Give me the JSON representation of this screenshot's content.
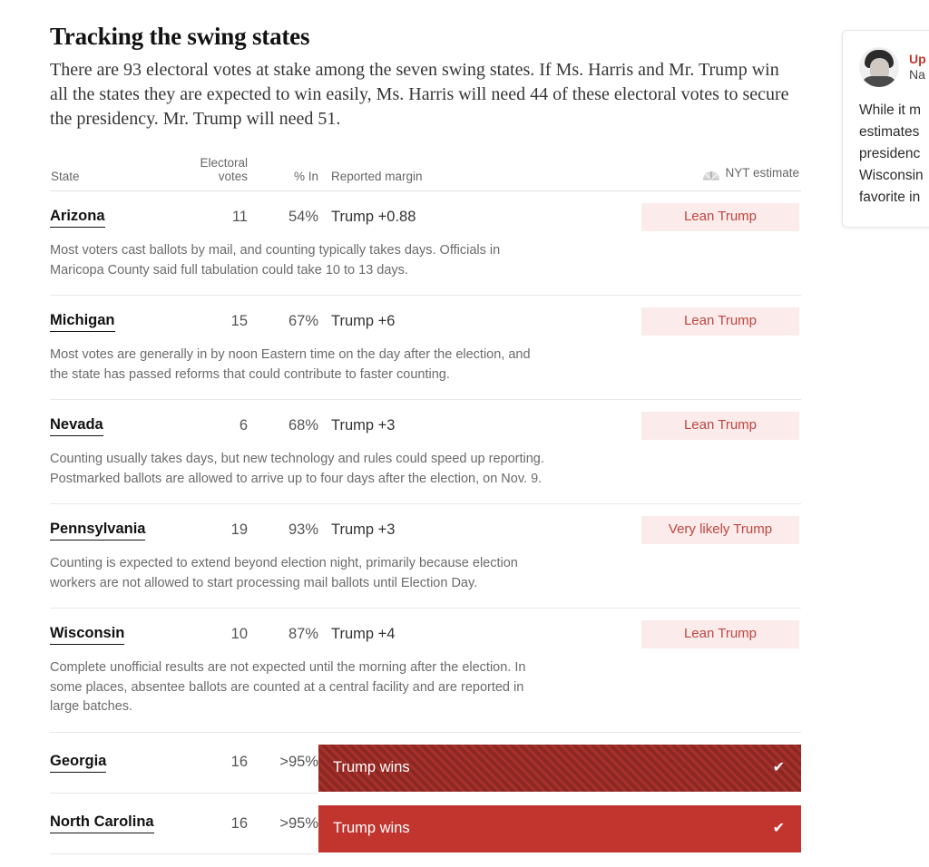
{
  "article": {
    "headline": "Tracking the swing states",
    "standfirst": "There are 93 electoral votes at stake among the seven swing states. If Ms. Harris and Mr. Trump win all the states they are expected to win easily, Ms. Harris will need 44 of these electoral votes to secure the presidency. Mr. Trump will need 51."
  },
  "table": {
    "headers": {
      "state": "State",
      "electoral_votes_line1": "Electoral",
      "electoral_votes_line2": "votes",
      "percent_in": "% In",
      "reported_margin": "Reported margin",
      "nyt_estimate": "NYT estimate",
      "nyt_estimate_icon": "fan-dial-icon"
    },
    "rows": [
      {
        "state": "Arizona",
        "electoral_votes": "11",
        "percent_in": "54%",
        "reported_margin": "Trump +0.88",
        "estimate": "Lean Trump",
        "called": false,
        "hatched": false,
        "note": "Most voters cast ballots by mail, and counting typically takes days. Officials in Maricopa County said full tabulation could take 10 to 13 days."
      },
      {
        "state": "Michigan",
        "electoral_votes": "15",
        "percent_in": "67%",
        "reported_margin": "Trump +6",
        "estimate": "Lean Trump",
        "called": false,
        "hatched": false,
        "note": "Most votes are generally in by noon Eastern time on the day after the election, and the state has passed reforms that could contribute to faster counting."
      },
      {
        "state": "Nevada",
        "electoral_votes": "6",
        "percent_in": "68%",
        "reported_margin": "Trump +3",
        "estimate": "Lean Trump",
        "called": false,
        "hatched": false,
        "note": "Counting usually takes days, but new technology and rules could speed up reporting. Postmarked ballots are allowed to arrive up to four days after the election, on Nov. 9."
      },
      {
        "state": "Pennsylvania",
        "electoral_votes": "19",
        "percent_in": "93%",
        "reported_margin": "Trump +3",
        "estimate": "Very likely Trump",
        "called": false,
        "hatched": false,
        "note": "Counting is expected to extend beyond election night, primarily because election workers are not allowed to start processing mail ballots until Election Day."
      },
      {
        "state": "Wisconsin",
        "electoral_votes": "10",
        "percent_in": "87%",
        "reported_margin": "Trump +4",
        "estimate": "Lean Trump",
        "called": false,
        "hatched": false,
        "note": "Complete unofficial results are not expected until the morning after the election. In some places, absentee ballots are counted at a central facility and are reported in large batches."
      },
      {
        "state": "Georgia",
        "electoral_votes": "16",
        "percent_in": ">95%",
        "reported_margin": "",
        "estimate": "Trump wins",
        "called": true,
        "hatched": true,
        "check": "✔",
        "note": ""
      },
      {
        "state": "North Carolina",
        "electoral_votes": "16",
        "percent_in": ">95%",
        "reported_margin": "",
        "estimate": "Trump wins",
        "called": true,
        "hatched": false,
        "check": "✔",
        "note": ""
      }
    ]
  },
  "update_card": {
    "kicker": "Up",
    "author": "Na",
    "body_lines": [
      "While it m",
      "estimates",
      "presidenc",
      "Wisconsin",
      "favorite in"
    ]
  },
  "colors": {
    "pill_bg": "#fbeceb",
    "pill_text": "#bf4540",
    "win_bar": "#c2352f",
    "win_bar_hatched": "#a8302b",
    "kicker": "#c0392f"
  }
}
